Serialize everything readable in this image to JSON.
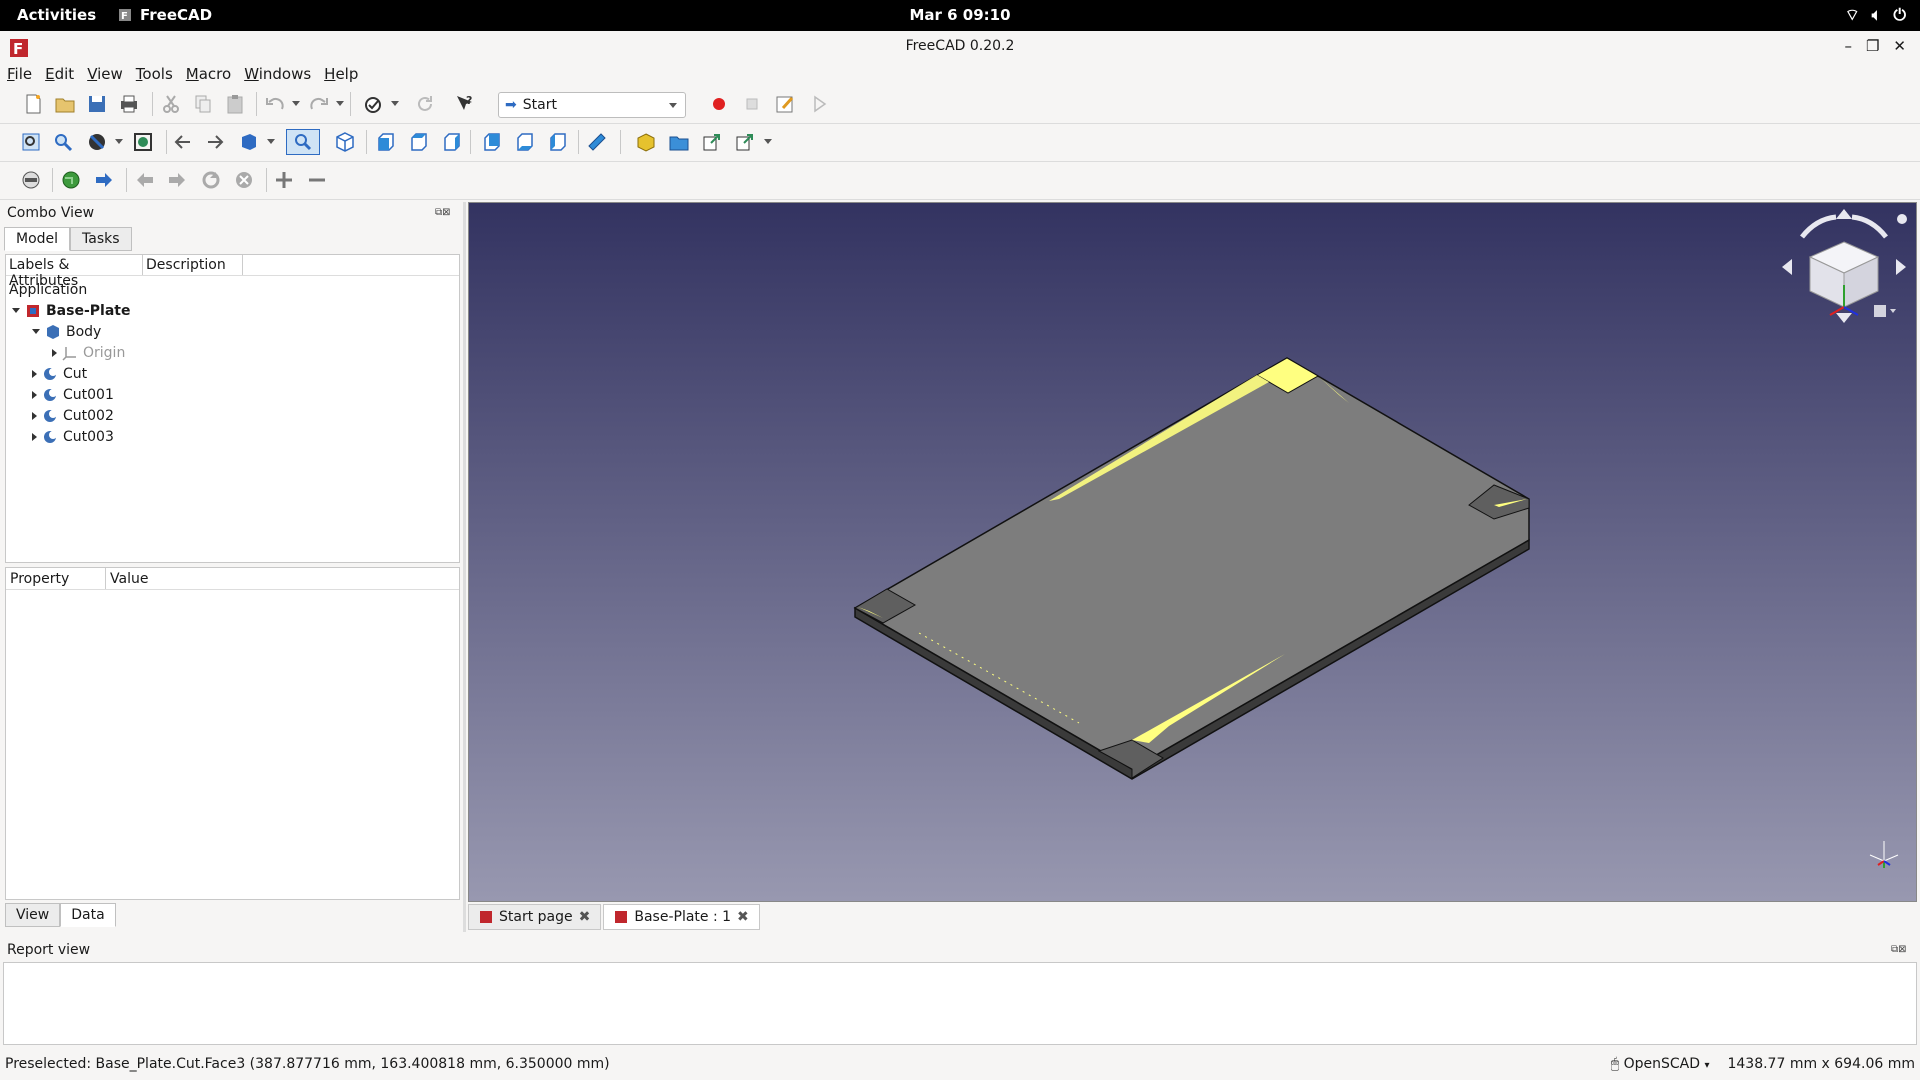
{
  "system_bar": {
    "activities": "Activities",
    "app_name": "FreeCAD",
    "clock": "Mar 6  09:10"
  },
  "window": {
    "title": "FreeCAD 0.20.2"
  },
  "menu": [
    "File",
    "Edit",
    "View",
    "Tools",
    "Macro",
    "Windows",
    "Help"
  ],
  "workbench_select": {
    "value": "Start"
  },
  "combo_view": {
    "title": "Combo View",
    "tabs": [
      "Model",
      "Tasks"
    ],
    "tree_headers": [
      "Labels & Attributes",
      "Description"
    ],
    "tree_root": "Application",
    "items": [
      {
        "label": "Base-Plate",
        "expanded": true,
        "bold": true
      },
      {
        "label": "Body",
        "expanded": true
      },
      {
        "label": "Origin",
        "expanded": false,
        "disabled": true
      },
      {
        "label": "Cut",
        "expanded": false
      },
      {
        "label": "Cut001",
        "expanded": false
      },
      {
        "label": "Cut002",
        "expanded": false
      },
      {
        "label": "Cut003",
        "expanded": false
      }
    ],
    "property_headers": [
      "Property",
      "Value"
    ],
    "bottom_tabs": [
      "View",
      "Data"
    ]
  },
  "doc_tabs": [
    {
      "label": "Start page"
    },
    {
      "label": "Base-Plate : 1"
    }
  ],
  "report_view": {
    "title": "Report view"
  },
  "status": {
    "preselected": "Preselected: Base_Plate.Cut.Face3 (387.877716 mm, 163.400818 mm, 6.350000 mm)",
    "navigation": "OpenSCAD",
    "dimensions": "1438.77 mm x 694.06 mm"
  },
  "colors": {
    "viewport_top": "#333361",
    "viewport_bottom": "#9898b0",
    "plate_face": "#7d7d7d",
    "highlight": "#ffff80"
  }
}
